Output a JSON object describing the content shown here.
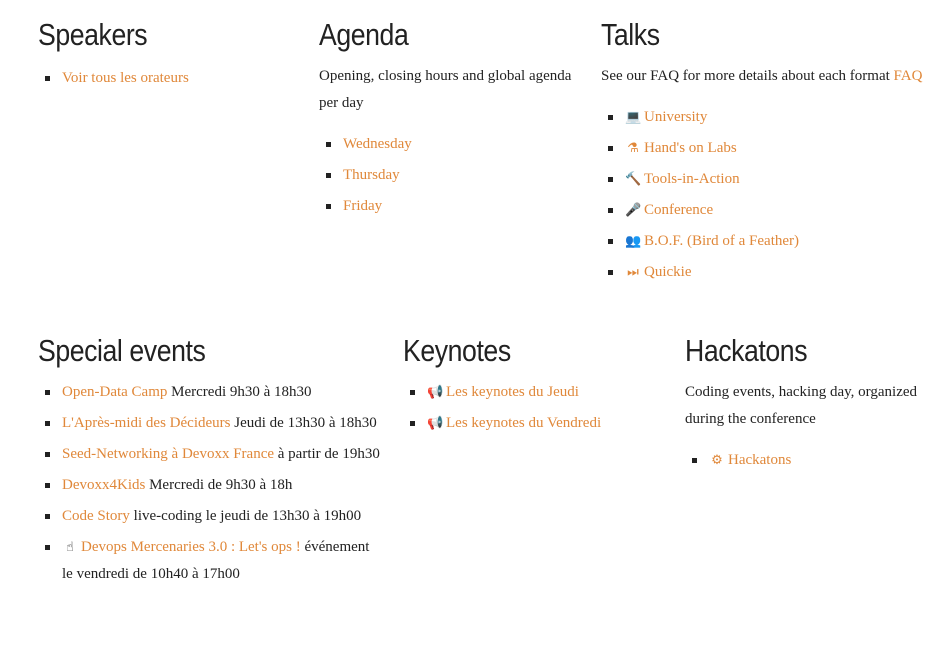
{
  "speakers": {
    "title": "Speakers",
    "items": [
      {
        "link": "Voir tous les orateurs"
      }
    ]
  },
  "agenda": {
    "title": "Agenda",
    "description": "Opening, closing hours and global agenda per day",
    "items": [
      {
        "link": "Wednesday"
      },
      {
        "link": "Thursday"
      },
      {
        "link": "Friday"
      }
    ]
  },
  "talks": {
    "title": "Talks",
    "description": "See our FAQ for more details about each format",
    "faq_link": "FAQ",
    "items": [
      {
        "icon": "laptop-icon",
        "glyph": "💻",
        "link": "University"
      },
      {
        "icon": "flask-icon",
        "glyph": "⚗",
        "link": "Hand's on Labs"
      },
      {
        "icon": "gavel-icon",
        "glyph": "🔨",
        "link": "Tools-in-Action"
      },
      {
        "icon": "microphone-icon",
        "glyph": "🎤",
        "link": "Conference"
      },
      {
        "icon": "users-icon",
        "glyph": "👥",
        "link": "B.O.F. (Bird of a Feather)"
      },
      {
        "icon": "fast-forward-icon",
        "glyph": "⏭",
        "link": "Quickie"
      }
    ]
  },
  "special_events": {
    "title": "Special events",
    "items": [
      {
        "link": "Open-Data Camp",
        "text": " Mercredi 9h30 à 18h30"
      },
      {
        "link": "L'Après-midi des Décideurs",
        "text": " Jeudi de 13h30 à 18h30"
      },
      {
        "link": "Seed-Networking à Devoxx France",
        "text": " à partir de 19h30"
      },
      {
        "link": "Devoxx4Kids",
        "text": " Mercredi de 9h30 à 18h"
      },
      {
        "link": "Code Story",
        "text": " live-coding le jeudi de 13h30 à 19h00"
      },
      {
        "link": "Devops Mercenaries 3.0 : Let's ops !",
        "text": " événement le vendredi de 10h40 à 17h00",
        "icon": "pointer-hand-icon",
        "glyph": "☝"
      }
    ]
  },
  "keynotes": {
    "title": "Keynotes",
    "items": [
      {
        "icon": "bullhorn-icon",
        "glyph": "📢",
        "link": "Les keynotes du Jeudi"
      },
      {
        "icon": "bullhorn-icon",
        "glyph": "📢",
        "link": "Les keynotes du Vendredi"
      }
    ]
  },
  "hackatons": {
    "title": "Hackatons",
    "description": "Coding events, hacking day, organized during the conference",
    "items": [
      {
        "icon": "cogs-icon",
        "glyph": "⚙",
        "link": "Hackatons"
      }
    ]
  },
  "colors": {
    "link": "#e0883a",
    "text": "#222222",
    "background": "#ffffff"
  }
}
